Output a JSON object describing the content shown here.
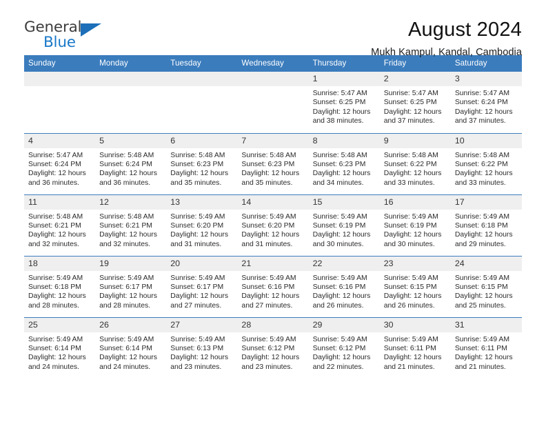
{
  "brand": {
    "name_top": "General",
    "name_bottom": "Blue",
    "accent_color": "#1878c8",
    "triangle_color": "#1c6fb8"
  },
  "header": {
    "month_title": "August 2024",
    "location": "Mukh Kampul, Kandal, Cambodia",
    "header_bg_color": "#3b7cbd"
  },
  "weekday_headers": [
    "Sunday",
    "Monday",
    "Tuesday",
    "Wednesday",
    "Thursday",
    "Friday",
    "Saturday"
  ],
  "labels": {
    "sunrise_prefix": "Sunrise:",
    "sunset_prefix": "Sunset:",
    "daylight_prefix": "Daylight:"
  },
  "weeks": [
    [
      {
        "day": "",
        "empty": true
      },
      {
        "day": "",
        "empty": true
      },
      {
        "day": "",
        "empty": true
      },
      {
        "day": "",
        "empty": true
      },
      {
        "day": "1",
        "sunrise": "Sunrise: 5:47 AM",
        "sunset": "Sunset: 6:25 PM",
        "daylight_line1": "Daylight: 12 hours",
        "daylight_line2": "and 38 minutes."
      },
      {
        "day": "2",
        "sunrise": "Sunrise: 5:47 AM",
        "sunset": "Sunset: 6:25 PM",
        "daylight_line1": "Daylight: 12 hours",
        "daylight_line2": "and 37 minutes."
      },
      {
        "day": "3",
        "sunrise": "Sunrise: 5:47 AM",
        "sunset": "Sunset: 6:24 PM",
        "daylight_line1": "Daylight: 12 hours",
        "daylight_line2": "and 37 minutes."
      }
    ],
    [
      {
        "day": "4",
        "sunrise": "Sunrise: 5:47 AM",
        "sunset": "Sunset: 6:24 PM",
        "daylight_line1": "Daylight: 12 hours",
        "daylight_line2": "and 36 minutes."
      },
      {
        "day": "5",
        "sunrise": "Sunrise: 5:48 AM",
        "sunset": "Sunset: 6:24 PM",
        "daylight_line1": "Daylight: 12 hours",
        "daylight_line2": "and 36 minutes."
      },
      {
        "day": "6",
        "sunrise": "Sunrise: 5:48 AM",
        "sunset": "Sunset: 6:23 PM",
        "daylight_line1": "Daylight: 12 hours",
        "daylight_line2": "and 35 minutes."
      },
      {
        "day": "7",
        "sunrise": "Sunrise: 5:48 AM",
        "sunset": "Sunset: 6:23 PM",
        "daylight_line1": "Daylight: 12 hours",
        "daylight_line2": "and 35 minutes."
      },
      {
        "day": "8",
        "sunrise": "Sunrise: 5:48 AM",
        "sunset": "Sunset: 6:23 PM",
        "daylight_line1": "Daylight: 12 hours",
        "daylight_line2": "and 34 minutes."
      },
      {
        "day": "9",
        "sunrise": "Sunrise: 5:48 AM",
        "sunset": "Sunset: 6:22 PM",
        "daylight_line1": "Daylight: 12 hours",
        "daylight_line2": "and 33 minutes."
      },
      {
        "day": "10",
        "sunrise": "Sunrise: 5:48 AM",
        "sunset": "Sunset: 6:22 PM",
        "daylight_line1": "Daylight: 12 hours",
        "daylight_line2": "and 33 minutes."
      }
    ],
    [
      {
        "day": "11",
        "sunrise": "Sunrise: 5:48 AM",
        "sunset": "Sunset: 6:21 PM",
        "daylight_line1": "Daylight: 12 hours",
        "daylight_line2": "and 32 minutes."
      },
      {
        "day": "12",
        "sunrise": "Sunrise: 5:48 AM",
        "sunset": "Sunset: 6:21 PM",
        "daylight_line1": "Daylight: 12 hours",
        "daylight_line2": "and 32 minutes."
      },
      {
        "day": "13",
        "sunrise": "Sunrise: 5:49 AM",
        "sunset": "Sunset: 6:20 PM",
        "daylight_line1": "Daylight: 12 hours",
        "daylight_line2": "and 31 minutes."
      },
      {
        "day": "14",
        "sunrise": "Sunrise: 5:49 AM",
        "sunset": "Sunset: 6:20 PM",
        "daylight_line1": "Daylight: 12 hours",
        "daylight_line2": "and 31 minutes."
      },
      {
        "day": "15",
        "sunrise": "Sunrise: 5:49 AM",
        "sunset": "Sunset: 6:19 PM",
        "daylight_line1": "Daylight: 12 hours",
        "daylight_line2": "and 30 minutes."
      },
      {
        "day": "16",
        "sunrise": "Sunrise: 5:49 AM",
        "sunset": "Sunset: 6:19 PM",
        "daylight_line1": "Daylight: 12 hours",
        "daylight_line2": "and 30 minutes."
      },
      {
        "day": "17",
        "sunrise": "Sunrise: 5:49 AM",
        "sunset": "Sunset: 6:18 PM",
        "daylight_line1": "Daylight: 12 hours",
        "daylight_line2": "and 29 minutes."
      }
    ],
    [
      {
        "day": "18",
        "sunrise": "Sunrise: 5:49 AM",
        "sunset": "Sunset: 6:18 PM",
        "daylight_line1": "Daylight: 12 hours",
        "daylight_line2": "and 28 minutes."
      },
      {
        "day": "19",
        "sunrise": "Sunrise: 5:49 AM",
        "sunset": "Sunset: 6:17 PM",
        "daylight_line1": "Daylight: 12 hours",
        "daylight_line2": "and 28 minutes."
      },
      {
        "day": "20",
        "sunrise": "Sunrise: 5:49 AM",
        "sunset": "Sunset: 6:17 PM",
        "daylight_line1": "Daylight: 12 hours",
        "daylight_line2": "and 27 minutes."
      },
      {
        "day": "21",
        "sunrise": "Sunrise: 5:49 AM",
        "sunset": "Sunset: 6:16 PM",
        "daylight_line1": "Daylight: 12 hours",
        "daylight_line2": "and 27 minutes."
      },
      {
        "day": "22",
        "sunrise": "Sunrise: 5:49 AM",
        "sunset": "Sunset: 6:16 PM",
        "daylight_line1": "Daylight: 12 hours",
        "daylight_line2": "and 26 minutes."
      },
      {
        "day": "23",
        "sunrise": "Sunrise: 5:49 AM",
        "sunset": "Sunset: 6:15 PM",
        "daylight_line1": "Daylight: 12 hours",
        "daylight_line2": "and 26 minutes."
      },
      {
        "day": "24",
        "sunrise": "Sunrise: 5:49 AM",
        "sunset": "Sunset: 6:15 PM",
        "daylight_line1": "Daylight: 12 hours",
        "daylight_line2": "and 25 minutes."
      }
    ],
    [
      {
        "day": "25",
        "sunrise": "Sunrise: 5:49 AM",
        "sunset": "Sunset: 6:14 PM",
        "daylight_line1": "Daylight: 12 hours",
        "daylight_line2": "and 24 minutes."
      },
      {
        "day": "26",
        "sunrise": "Sunrise: 5:49 AM",
        "sunset": "Sunset: 6:14 PM",
        "daylight_line1": "Daylight: 12 hours",
        "daylight_line2": "and 24 minutes."
      },
      {
        "day": "27",
        "sunrise": "Sunrise: 5:49 AM",
        "sunset": "Sunset: 6:13 PM",
        "daylight_line1": "Daylight: 12 hours",
        "daylight_line2": "and 23 minutes."
      },
      {
        "day": "28",
        "sunrise": "Sunrise: 5:49 AM",
        "sunset": "Sunset: 6:12 PM",
        "daylight_line1": "Daylight: 12 hours",
        "daylight_line2": "and 23 minutes."
      },
      {
        "day": "29",
        "sunrise": "Sunrise: 5:49 AM",
        "sunset": "Sunset: 6:12 PM",
        "daylight_line1": "Daylight: 12 hours",
        "daylight_line2": "and 22 minutes."
      },
      {
        "day": "30",
        "sunrise": "Sunrise: 5:49 AM",
        "sunset": "Sunset: 6:11 PM",
        "daylight_line1": "Daylight: 12 hours",
        "daylight_line2": "and 21 minutes."
      },
      {
        "day": "31",
        "sunrise": "Sunrise: 5:49 AM",
        "sunset": "Sunset: 6:11 PM",
        "daylight_line1": "Daylight: 12 hours",
        "daylight_line2": "and 21 minutes."
      }
    ]
  ]
}
